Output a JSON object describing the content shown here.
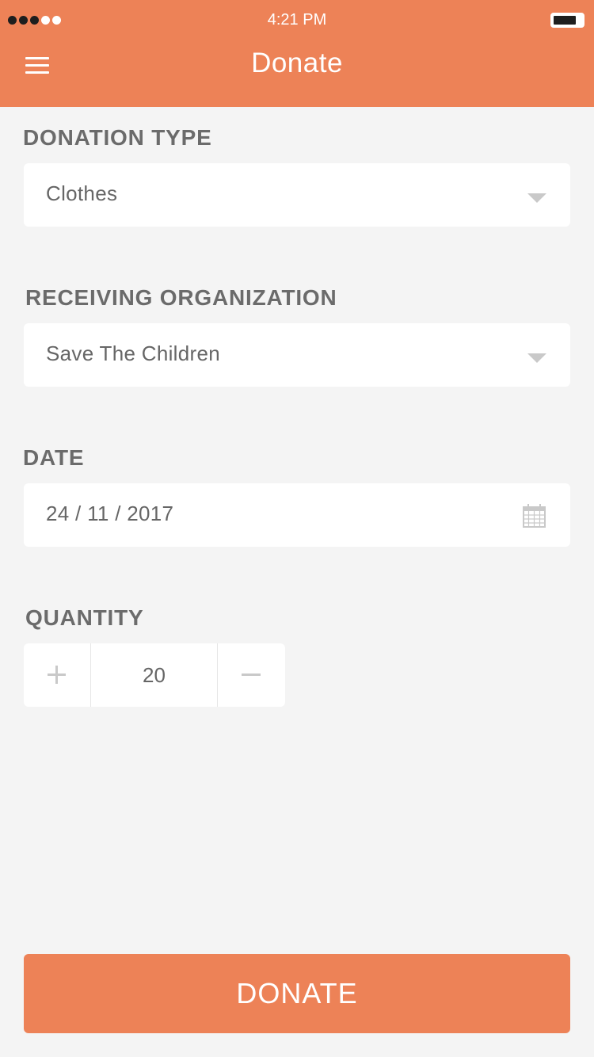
{
  "status_bar": {
    "signal_filled": 3,
    "signal_total": 5,
    "time": "4:21 PM"
  },
  "header": {
    "title": "Donate",
    "menu_icon": "hamburger-menu-icon",
    "background_color": "#ed8257"
  },
  "form": {
    "donation_type": {
      "label": "DONATION TYPE",
      "value": "Clothes"
    },
    "receiving_organization": {
      "label": "RECEIVING ORGANIZATION",
      "value": "Save The Children"
    },
    "date": {
      "label": "DATE",
      "value": "24 / 11 / 2017",
      "icon": "calendar-icon"
    },
    "quantity": {
      "label": "QUANTITY",
      "value": "20",
      "increment_icon": "plus-icon",
      "decrement_icon": "minus-icon"
    }
  },
  "donate_button": {
    "label": "DONATE"
  },
  "colors": {
    "accent": "#ed8257",
    "background": "#f4f4f4",
    "text": "#666666",
    "icon_gray": "#c9c9c9"
  }
}
